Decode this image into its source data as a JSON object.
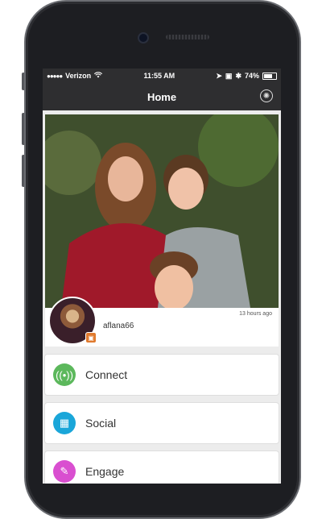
{
  "status_bar": {
    "signal_dots": "●●●●●",
    "carrier": "Verizon",
    "wifi_icon": "wifi-icon",
    "time": "11:55 AM",
    "battery_percent": "74%"
  },
  "nav": {
    "title": "Home",
    "settings_icon": "gear-icon"
  },
  "post": {
    "username": "aflana66",
    "timestamp": "13 hours ago"
  },
  "menu": [
    {
      "label": "Connect",
      "icon": "broadcast-icon",
      "color": "#5cb85c"
    },
    {
      "label": "Social",
      "icon": "image-icon",
      "color": "#1aa6d9"
    },
    {
      "label": "Engage",
      "icon": "edit-icon",
      "color": "#d94fd0"
    }
  ]
}
